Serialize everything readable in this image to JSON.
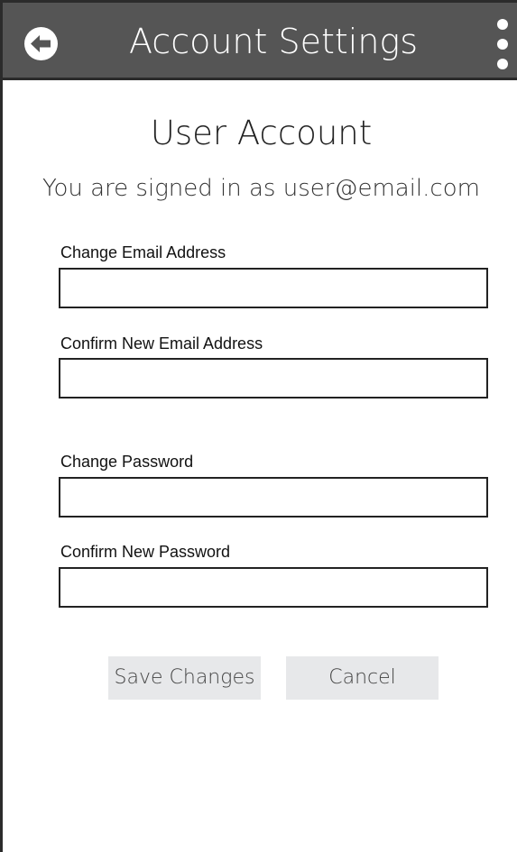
{
  "header": {
    "title": "Account Settings",
    "back_icon": "arrow-left-circle-icon",
    "menu_icon": "more-vertical-icon"
  },
  "account": {
    "title": "User Account",
    "signed_in_text": "You are signed in as user@email.com"
  },
  "form": {
    "fields": [
      {
        "label": "Change Email Address",
        "value": "",
        "type": "email"
      },
      {
        "label": "Confirm New Email Address",
        "value": "",
        "type": "email"
      },
      {
        "label": "Change Password",
        "value": "",
        "type": "password"
      },
      {
        "label": "Confirm New Password",
        "value": "",
        "type": "password"
      }
    ],
    "save_label": "Save Changes",
    "cancel_label": "Cancel"
  },
  "colors": {
    "header_bg": "#555555",
    "button_bg": "#e7e8ea",
    "border": "#222222"
  }
}
